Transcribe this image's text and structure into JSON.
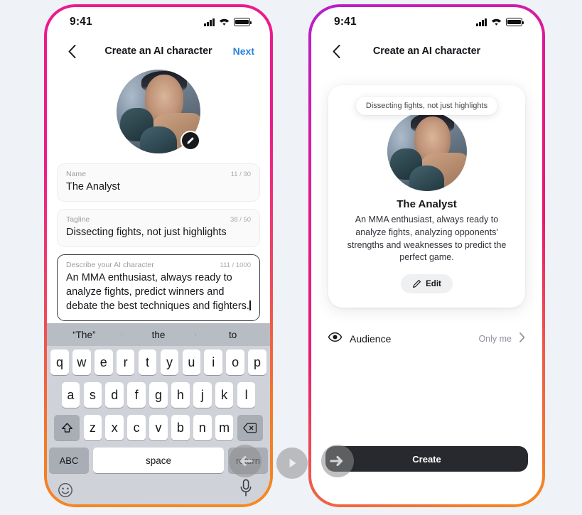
{
  "theme": {
    "page_background": "#eff2f6",
    "accent_blue": "#2a7fe0",
    "frame_gradient_start": "#ec1a8d",
    "frame_gradient_end": "#f58a20",
    "create_button_bg": "#27292e"
  },
  "left_phone": {
    "status": {
      "time": "9:41",
      "signal_icon": "cellular-signal-icon",
      "wifi_icon": "wifi-icon",
      "battery_icon": "battery-icon"
    },
    "nav": {
      "back_icon": "chevron-left-icon",
      "title": "Create an AI character",
      "next_label": "Next"
    },
    "avatar": {
      "name": "character-avatar",
      "edit_icon": "pencil-icon"
    },
    "fields": [
      {
        "key": "name",
        "label": "Name",
        "count": "11 / 30",
        "value": "The Analyst",
        "focused": false
      },
      {
        "key": "tagline",
        "label": "Tagline",
        "count": "38 / 50",
        "value": "Dissecting fights, not just highlights",
        "focused": false
      },
      {
        "key": "description",
        "label": "Describe your AI character",
        "count": "111 / 1000",
        "value": "An MMA enthusiast, always ready to analyze fights, predict winners and debate the best techniques and fighters.",
        "focused": true
      }
    ],
    "keyboard": {
      "suggestions": [
        "“The”",
        "the",
        "to"
      ],
      "row1": [
        "q",
        "w",
        "e",
        "r",
        "t",
        "y",
        "u",
        "i",
        "o",
        "p"
      ],
      "row2": [
        "a",
        "s",
        "d",
        "f",
        "g",
        "h",
        "j",
        "k",
        "l"
      ],
      "row3": [
        "z",
        "x",
        "c",
        "v",
        "b",
        "n",
        "m"
      ],
      "shift_icon": "shift-up-icon",
      "backspace_icon": "backspace-icon",
      "abc_label": "ABC",
      "space_label": "space",
      "return_label": "return",
      "emoji_icon": "emoji-smiley-icon",
      "mic_icon": "microphone-icon"
    },
    "cursor": {
      "icon": "cursor-arrow-left-icon"
    }
  },
  "right_phone": {
    "status": {
      "time": "9:41",
      "signal_icon": "cellular-signal-icon",
      "wifi_icon": "wifi-icon",
      "battery_icon": "battery-icon"
    },
    "nav": {
      "back_icon": "chevron-left-icon",
      "title": "Create an AI character"
    },
    "preview": {
      "tagline": "Dissecting fights, not just highlights",
      "name": "The Analyst",
      "description": "An MMA enthusiast, always ready to analyze fights, analyzing opponents' strengths and weaknesses to predict the perfect game.",
      "edit_label": "Edit",
      "edit_icon": "pencil-icon"
    },
    "audience": {
      "icon": "eye-audience-icon",
      "label": "Audience",
      "value": "Only me",
      "chevron_icon": "chevron-right-icon"
    },
    "create_button": {
      "label": "Create"
    },
    "cursor": {
      "icon": "cursor-arrow-right-icon"
    }
  },
  "play_control": {
    "icon": "play-icon"
  }
}
